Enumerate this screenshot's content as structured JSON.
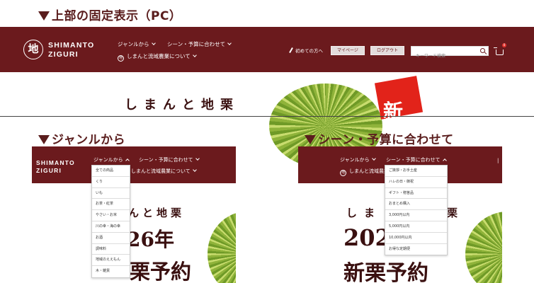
{
  "pc_label": "上部の固定表示（PC）",
  "genre_label": "ジャンルから",
  "scene_label": "シーン・予算に合わせて",
  "logo": {
    "char": "地",
    "line1": "SHIMANTO",
    "line2": "ZIGURI"
  },
  "nav": {
    "genre": "ジャンルから",
    "scene": "シーン・予算に合わせて",
    "about": "しまんと流域農業について",
    "about_icon": "地"
  },
  "header_right": {
    "first_time": "初めての方へ",
    "mypage": "マイページ",
    "logout": "ログアウト",
    "search_placeholder": "キーワード検索",
    "cart_count": "0"
  },
  "hero": {
    "title": "しまんと地栗",
    "tag_char": "新"
  },
  "genre_menu": [
    "全ての商品",
    "くり",
    "いも",
    "お茶・紅茶",
    "やさい・お米",
    "川の幸・海の幸",
    "お酒",
    "調味料",
    "地域のええもん",
    "木・雑貨"
  ],
  "scene_menu": [
    "ご挨拶・お手土産",
    "ハレの日・御祝",
    "ギフト・贈答品",
    "おまとめ購入",
    "3,000円以内",
    "5,000円以内",
    "10,000円以内",
    "お得な定期便"
  ],
  "genre_shot": {
    "title_part": "んと地栗",
    "year": "26年",
    "reserve": "栗予約"
  },
  "scene_shot": {
    "title_part": "しま",
    "title_part2": "栗",
    "year": "202",
    "reserve": "新栗予約"
  },
  "colors": {
    "brand": "#6b1a1d",
    "accent": "#e2231a",
    "label": "#5a1d1d"
  },
  "icons": [
    "triangle-down-icon",
    "logo-circle-icon",
    "chevron-down-icon",
    "chevron-up-icon",
    "pen-icon",
    "search-icon",
    "cart-icon"
  ]
}
